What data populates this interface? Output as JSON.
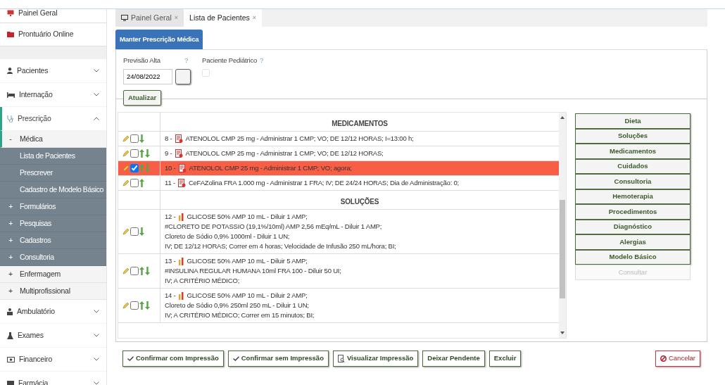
{
  "sidebar": {
    "top_items": [
      {
        "label": "Painel Geral"
      },
      {
        "label": "Prontuário Online"
      }
    ],
    "items": [
      {
        "label": "Pacientes",
        "selected": false,
        "expanded": false
      },
      {
        "label": "Internação",
        "selected": false,
        "expanded": false
      },
      {
        "label": "Prescrição",
        "selected": true,
        "expanded": true,
        "children": [
          {
            "sign": "-",
            "label": "Médica",
            "expanded": true,
            "children": [
              {
                "label": "Lista de Pacientes",
                "kind": "leaf"
              },
              {
                "label": "Prescrever",
                "kind": "leaf"
              },
              {
                "label": "Cadastro de Modelo Básico",
                "kind": "leaf"
              },
              {
                "sign": "+",
                "label": "Formulários",
                "kind": "group"
              },
              {
                "sign": "+",
                "label": "Pesquisas",
                "kind": "group"
              },
              {
                "sign": "+",
                "label": "Cadastros",
                "kind": "group"
              },
              {
                "sign": "+",
                "label": "Consultoria",
                "kind": "group"
              }
            ]
          },
          {
            "sign": "+",
            "label": "Enfermagem"
          },
          {
            "sign": "+",
            "label": "Multiprofissional"
          }
        ]
      },
      {
        "label": "Ambulatório",
        "selected": false,
        "expanded": false
      },
      {
        "label": "Exames",
        "selected": false,
        "expanded": false
      },
      {
        "label": "Financeiro",
        "selected": false,
        "expanded": false
      },
      {
        "label": "Farmácia",
        "selected": false,
        "expanded": false
      }
    ]
  },
  "tabs": [
    {
      "label": "Painel Geral",
      "close": "×",
      "selected": false
    },
    {
      "label": "Lista de Pacientes",
      "close": "×",
      "selected": true
    }
  ],
  "panel": {
    "title": "Manter Prescrição Médica",
    "form": {
      "discharge": {
        "label": "Previsão Alta",
        "help": "?",
        "value": "24/08/2022"
      },
      "pediatric": {
        "label": "Paciente Pediátrico",
        "help": "?",
        "checked": false
      },
      "update_button": "Atualizar"
    },
    "sections": [
      {
        "title": "MEDICAMENTOS",
        "kind": "medication",
        "rows": [
          {
            "number": "8 -",
            "lines": [
              "ATENOLOL CMP 25 mg - Administrar 1 CMP; VO; DE 12/12 HORAS; I=13:00 h;"
            ],
            "checked": false,
            "selected": false,
            "up": false,
            "down": true
          },
          {
            "number": "9 -",
            "lines": [
              "ATENOLOL CMP 25 mg - Administrar 1 CMP; VO; DE 12/12 HORAS;"
            ],
            "checked": false,
            "selected": false,
            "up": true,
            "down": true
          },
          {
            "number": "10 -",
            "lines": [
              "ATENOLOL CMP 25 mg - Administrar 1 CMP; VO; agora;"
            ],
            "checked": true,
            "selected": true,
            "up": true,
            "down": true
          },
          {
            "number": "11 -",
            "lines": [
              "CeFAZolina FRA 1.000 mg - Administrar 1 FRA; IV; DE 24/24 HORAS; Dia de Administração: 0;"
            ],
            "checked": false,
            "selected": false,
            "up": true,
            "down": false
          }
        ]
      },
      {
        "title": "SOLUÇÕES",
        "kind": "solution",
        "rows": [
          {
            "number": "12 -",
            "lines": [
              "GLICOSE 50% AMP 10 mL - Diluir 1 AMP;",
              "#CLORETO DE POTASSIO (19,1%/10ml) AMP 2,56 mEq/mL - Diluir 1 AMP;",
              "Cloreto de Sódio 0,9% 1000ml - Diluir 1 UN;",
              "IV; DE 12/12 HORAS; Correr em 4 horas; Velocidade de Infusão 250 mL/hora; BI;"
            ],
            "checked": false,
            "selected": false,
            "up": false,
            "down": true
          },
          {
            "number": "13 -",
            "lines": [
              "GLICOSE 50% AMP 10 mL - Diluir 5 AMP;",
              "#INSULINA REGULAR HUMANA 10ml FRA 100 - Diluir 50 UI;",
              "IV; A CRITÉRIO MÉDICO;"
            ],
            "checked": false,
            "selected": false,
            "up": true,
            "down": true
          },
          {
            "number": "14 -",
            "lines": [
              "GLICOSE 50% AMP 10 mL - Diluir 2 AMP;",
              "Cloreto de Sódio 0,9% 250ml 250 mL - Diluir 1 UN;",
              "IV; A CRITÉRIO MÉDICO; Correr em 15 minutos; BI;"
            ],
            "checked": false,
            "selected": false,
            "up": true,
            "down": true
          }
        ]
      }
    ],
    "side_buttons": [
      {
        "label": "Dieta",
        "disabled": false
      },
      {
        "label": "Soluções",
        "disabled": false
      },
      {
        "label": "Medicamentos",
        "disabled": false
      },
      {
        "label": "Cuidados",
        "disabled": false
      },
      {
        "label": "Consultoria",
        "disabled": false
      },
      {
        "label": "Hemoterapia",
        "disabled": false
      },
      {
        "label": "Procedimentos",
        "disabled": false
      },
      {
        "label": "Diagnóstico",
        "disabled": false
      },
      {
        "label": "Alergias",
        "disabled": false
      },
      {
        "label": "Modelo Básico",
        "disabled": false
      },
      {
        "label": "Consultar",
        "disabled": true
      }
    ],
    "actions": [
      {
        "label": "Confirmar com Impressão",
        "kind": "check"
      },
      {
        "label": "Confirmar sem Impressão",
        "kind": "check"
      },
      {
        "label": "Visualizar Impressão",
        "kind": "preview"
      },
      {
        "label": "Deixar Pendente",
        "kind": "plain"
      },
      {
        "label": "Excluir",
        "kind": "plain"
      }
    ],
    "cancel_button": "Cancelar"
  }
}
